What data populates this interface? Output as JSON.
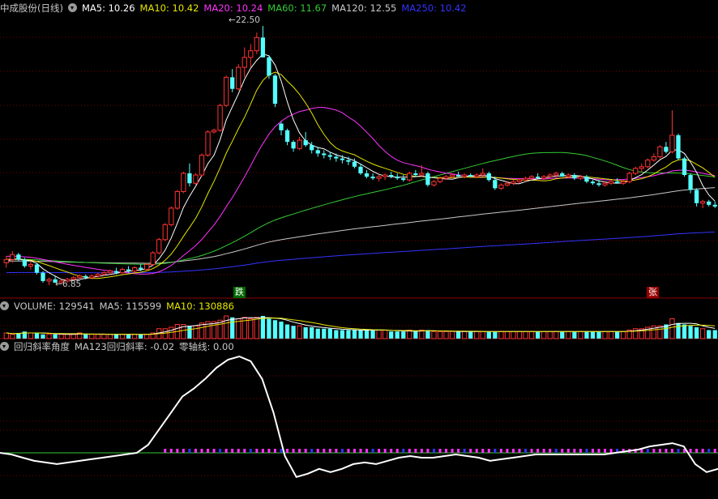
{
  "main": {
    "title": "中成股份(日线)",
    "ma": [
      {
        "label": "MA5: 10.26",
        "color": "#ffffff"
      },
      {
        "label": "MA10: 10.42",
        "color": "#e6e600"
      },
      {
        "label": "MA20: 10.24",
        "color": "#ff33ff"
      },
      {
        "label": "MA60: 11.67",
        "color": "#33cc33"
      },
      {
        "label": "MA120: 12.55",
        "color": "#c8c8c8"
      },
      {
        "label": "MA250: 10.42",
        "color": "#3333ff"
      }
    ],
    "high_label": "22.50",
    "low_label": "6.85",
    "tag_down": "跌",
    "tag_up": "张"
  },
  "volume": {
    "items": [
      {
        "label": "VOLUME: 129541",
        "color": "#c8c8c8"
      },
      {
        "label": "MA5: 115599",
        "color": "#c8c8c8"
      },
      {
        "label": "MA10: 130886",
        "color": "#e6e600"
      }
    ]
  },
  "indicator": {
    "title": "回归斜率角度",
    "items": [
      {
        "label": "MA123回归斜率: -0.02",
        "color": "#c8c8c8"
      },
      {
        "label": "零轴线: 0.00",
        "color": "#c8c8c8"
      }
    ]
  },
  "chart_data": {
    "type": "candlestick",
    "candles": [
      [
        8.2,
        8.6,
        7.9,
        8.4
      ],
      [
        8.4,
        8.9,
        8.2,
        8.7
      ],
      [
        8.7,
        8.8,
        8.3,
        8.4
      ],
      [
        8.4,
        8.5,
        7.9,
        8.0
      ],
      [
        8.0,
        8.3,
        7.8,
        8.1
      ],
      [
        8.1,
        8.2,
        7.5,
        7.6
      ],
      [
        7.6,
        7.7,
        7.0,
        7.1
      ],
      [
        7.1,
        7.3,
        6.85,
        7.2
      ],
      [
        7.2,
        7.4,
        7.0,
        7.0
      ],
      [
        7.0,
        7.2,
        6.9,
        7.1
      ],
      [
        7.1,
        7.3,
        7.0,
        7.2
      ],
      [
        7.2,
        7.4,
        7.1,
        7.3
      ],
      [
        7.3,
        7.5,
        7.2,
        7.4
      ],
      [
        7.4,
        7.5,
        7.2,
        7.3
      ],
      [
        7.3,
        7.5,
        7.2,
        7.4
      ],
      [
        7.4,
        7.6,
        7.3,
        7.5
      ],
      [
        7.5,
        7.7,
        7.4,
        7.6
      ],
      [
        7.6,
        7.8,
        7.5,
        7.7
      ],
      [
        7.7,
        7.9,
        7.5,
        7.6
      ],
      [
        7.6,
        7.9,
        7.5,
        7.8
      ],
      [
        7.8,
        8.0,
        7.6,
        7.7
      ],
      [
        7.7,
        8.0,
        7.6,
        7.9
      ],
      [
        7.9,
        8.1,
        7.7,
        7.8
      ],
      [
        7.8,
        8.2,
        7.7,
        8.1
      ],
      [
        8.1,
        8.9,
        8.0,
        8.8
      ],
      [
        8.8,
        9.7,
        8.7,
        9.6
      ],
      [
        9.6,
        10.6,
        9.5,
        10.5
      ],
      [
        10.5,
        11.6,
        10.4,
        11.5
      ],
      [
        11.5,
        12.6,
        11.4,
        12.5
      ],
      [
        12.5,
        13.7,
        12.4,
        13.6
      ],
      [
        13.6,
        14.2,
        12.8,
        13.0
      ],
      [
        13.0,
        13.6,
        12.9,
        13.5
      ],
      [
        13.5,
        14.8,
        13.4,
        14.7
      ],
      [
        14.7,
        16.2,
        14.6,
        16.1
      ],
      [
        16.1,
        16.3,
        16.0,
        16.2
      ],
      [
        16.2,
        17.8,
        16.1,
        17.7
      ],
      [
        17.7,
        19.5,
        17.6,
        19.4
      ],
      [
        19.4,
        19.9,
        18.5,
        18.7
      ],
      [
        18.7,
        20.2,
        18.6,
        20.0
      ],
      [
        20.0,
        21.2,
        19.4,
        20.6
      ],
      [
        20.6,
        21.4,
        20.0,
        21.0
      ],
      [
        21.0,
        22.1,
        20.8,
        21.8
      ],
      [
        21.8,
        22.5,
        20.6,
        20.6
      ],
      [
        20.6,
        20.7,
        19.3,
        19.5
      ],
      [
        19.5,
        19.6,
        17.6,
        17.8
      ],
      [
        16.6,
        16.7,
        15.9,
        16.2
      ],
      [
        16.2,
        16.3,
        15.3,
        15.5
      ],
      [
        15.5,
        15.6,
        14.9,
        15.1
      ],
      [
        15.1,
        15.8,
        15.0,
        15.6
      ],
      [
        15.6,
        16.1,
        15.2,
        15.3
      ],
      [
        15.3,
        15.5,
        14.8,
        15.0
      ],
      [
        15.0,
        15.2,
        14.6,
        14.8
      ],
      [
        14.8,
        15.0,
        14.5,
        14.7
      ],
      [
        14.7,
        14.9,
        14.4,
        14.6
      ],
      [
        14.6,
        14.8,
        14.3,
        14.5
      ],
      [
        14.5,
        14.7,
        14.2,
        14.4
      ],
      [
        14.4,
        14.6,
        14.1,
        14.3
      ],
      [
        14.3,
        14.5,
        13.9,
        14.0
      ],
      [
        14.0,
        14.2,
        13.5,
        13.6
      ],
      [
        13.6,
        13.8,
        13.3,
        13.4
      ],
      [
        13.4,
        13.6,
        13.2,
        13.3
      ],
      [
        13.3,
        13.5,
        13.1,
        13.4
      ],
      [
        13.4,
        13.6,
        13.2,
        13.5
      ],
      [
        13.5,
        13.7,
        13.3,
        13.4
      ],
      [
        13.4,
        13.6,
        13.2,
        13.3
      ],
      [
        13.3,
        13.5,
        13.1,
        13.2
      ],
      [
        13.2,
        13.7,
        13.1,
        13.6
      ],
      [
        13.6,
        13.8,
        13.4,
        13.5
      ],
      [
        13.5,
        14.1,
        13.4,
        13.6
      ],
      [
        13.6,
        13.7,
        12.8,
        12.9
      ],
      [
        12.9,
        13.2,
        12.8,
        13.1
      ],
      [
        13.1,
        13.4,
        13.0,
        13.3
      ],
      [
        13.3,
        13.5,
        13.2,
        13.4
      ],
      [
        13.4,
        13.6,
        13.3,
        13.5
      ],
      [
        13.5,
        13.7,
        13.4,
        13.4
      ],
      [
        13.4,
        13.6,
        13.3,
        13.5
      ],
      [
        13.5,
        13.6,
        13.4,
        13.4
      ],
      [
        13.4,
        13.6,
        13.3,
        13.5
      ],
      [
        13.5,
        13.9,
        13.4,
        13.6
      ],
      [
        13.6,
        13.7,
        13.1,
        13.2
      ],
      [
        13.2,
        13.4,
        12.6,
        12.7
      ],
      [
        12.7,
        13.0,
        12.6,
        12.9
      ],
      [
        12.9,
        13.1,
        12.8,
        13.0
      ],
      [
        13.0,
        13.2,
        12.9,
        13.1
      ],
      [
        13.1,
        13.3,
        13.0,
        13.2
      ],
      [
        13.2,
        13.4,
        13.1,
        13.3
      ],
      [
        13.3,
        13.5,
        13.2,
        13.4
      ],
      [
        13.4,
        13.6,
        13.3,
        13.3
      ],
      [
        13.3,
        13.5,
        13.2,
        13.4
      ],
      [
        13.4,
        13.6,
        13.3,
        13.5
      ],
      [
        13.5,
        13.7,
        13.3,
        13.6
      ],
      [
        13.6,
        13.7,
        13.4,
        13.4
      ],
      [
        13.4,
        13.6,
        13.3,
        13.5
      ],
      [
        13.5,
        13.6,
        13.2,
        13.3
      ],
      [
        13.3,
        13.5,
        13.2,
        13.4
      ],
      [
        13.4,
        13.5,
        13.0,
        13.1
      ],
      [
        13.1,
        13.2,
        12.9,
        13.0
      ],
      [
        13.0,
        13.2,
        12.8,
        12.9
      ],
      [
        12.9,
        13.1,
        12.8,
        13.0
      ],
      [
        13.0,
        13.2,
        12.9,
        13.1
      ],
      [
        13.1,
        13.3,
        13.0,
        13.0
      ],
      [
        13.0,
        13.2,
        12.9,
        13.1
      ],
      [
        13.1,
        13.7,
        13.0,
        13.6
      ],
      [
        13.6,
        14.0,
        13.5,
        13.9
      ],
      [
        13.9,
        14.2,
        13.7,
        14.0
      ],
      [
        14.0,
        14.5,
        13.9,
        14.4
      ],
      [
        14.4,
        14.8,
        14.3,
        14.6
      ],
      [
        14.6,
        15.3,
        14.5,
        15.2
      ],
      [
        15.2,
        15.5,
        14.8,
        14.9
      ],
      [
        14.9,
        17.4,
        14.8,
        15.9
      ],
      [
        15.9,
        16.0,
        14.4,
        14.5
      ],
      [
        14.5,
        14.6,
        13.4,
        13.5
      ],
      [
        13.5,
        13.6,
        12.4,
        12.6
      ],
      [
        12.6,
        12.7,
        11.6,
        11.8
      ],
      [
        11.8,
        12.0,
        11.5,
        11.9
      ],
      [
        11.9,
        12.0,
        11.6,
        11.7
      ],
      [
        11.7,
        11.9,
        11.5,
        11.6
      ]
    ],
    "volume": [
      4,
      3,
      4,
      5,
      4,
      4,
      3,
      3,
      3,
      3,
      3,
      3,
      4,
      3,
      3,
      3,
      3,
      3,
      3,
      3,
      3,
      3,
      3,
      3,
      4,
      7,
      7,
      8,
      10,
      10,
      9,
      9,
      11,
      12,
      12,
      13,
      16,
      15,
      14,
      15,
      14,
      15,
      16,
      14,
      13,
      12,
      10,
      9,
      9,
      8,
      8,
      7,
      7,
      7,
      6,
      6,
      6,
      6,
      6,
      6,
      6,
      6,
      6,
      5,
      5,
      5,
      6,
      5,
      6,
      6,
      5,
      5,
      5,
      5,
      5,
      5,
      5,
      5,
      5,
      5,
      5,
      5,
      5,
      5,
      5,
      5,
      5,
      5,
      5,
      5,
      5,
      5,
      5,
      5,
      5,
      5,
      5,
      5,
      5,
      5,
      5,
      5,
      6,
      7,
      7,
      8,
      9,
      9,
      10,
      14,
      11,
      10,
      9,
      8,
      7,
      6,
      6
    ],
    "regression_angle": [
      0.0,
      -0.1,
      -0.3,
      -0.5,
      -0.6,
      -0.7,
      -0.6,
      -0.5,
      -0.4,
      -0.3,
      -0.2,
      -0.1,
      0.0,
      0.5,
      1.5,
      2.5,
      3.5,
      4.0,
      4.6,
      5.3,
      5.8,
      6.0,
      5.7,
      4.6,
      2.5,
      -0.2,
      -1.5,
      -1.3,
      -1.0,
      -1.2,
      -1.0,
      -0.7,
      -0.6,
      -0.7,
      -0.5,
      -0.3,
      -0.2,
      -0.3,
      -0.3,
      -0.2,
      -0.1,
      -0.2,
      -0.3,
      -0.5,
      -0.4,
      -0.3,
      -0.2,
      -0.1,
      -0.1,
      -0.1,
      -0.1,
      -0.1,
      -0.1,
      -0.1,
      0.0,
      0.1,
      0.2,
      0.4,
      0.5,
      0.6,
      0.4,
      -0.7,
      -1.2,
      -1.0
    ],
    "ylim_price": [
      6.85,
      22.5
    ]
  }
}
